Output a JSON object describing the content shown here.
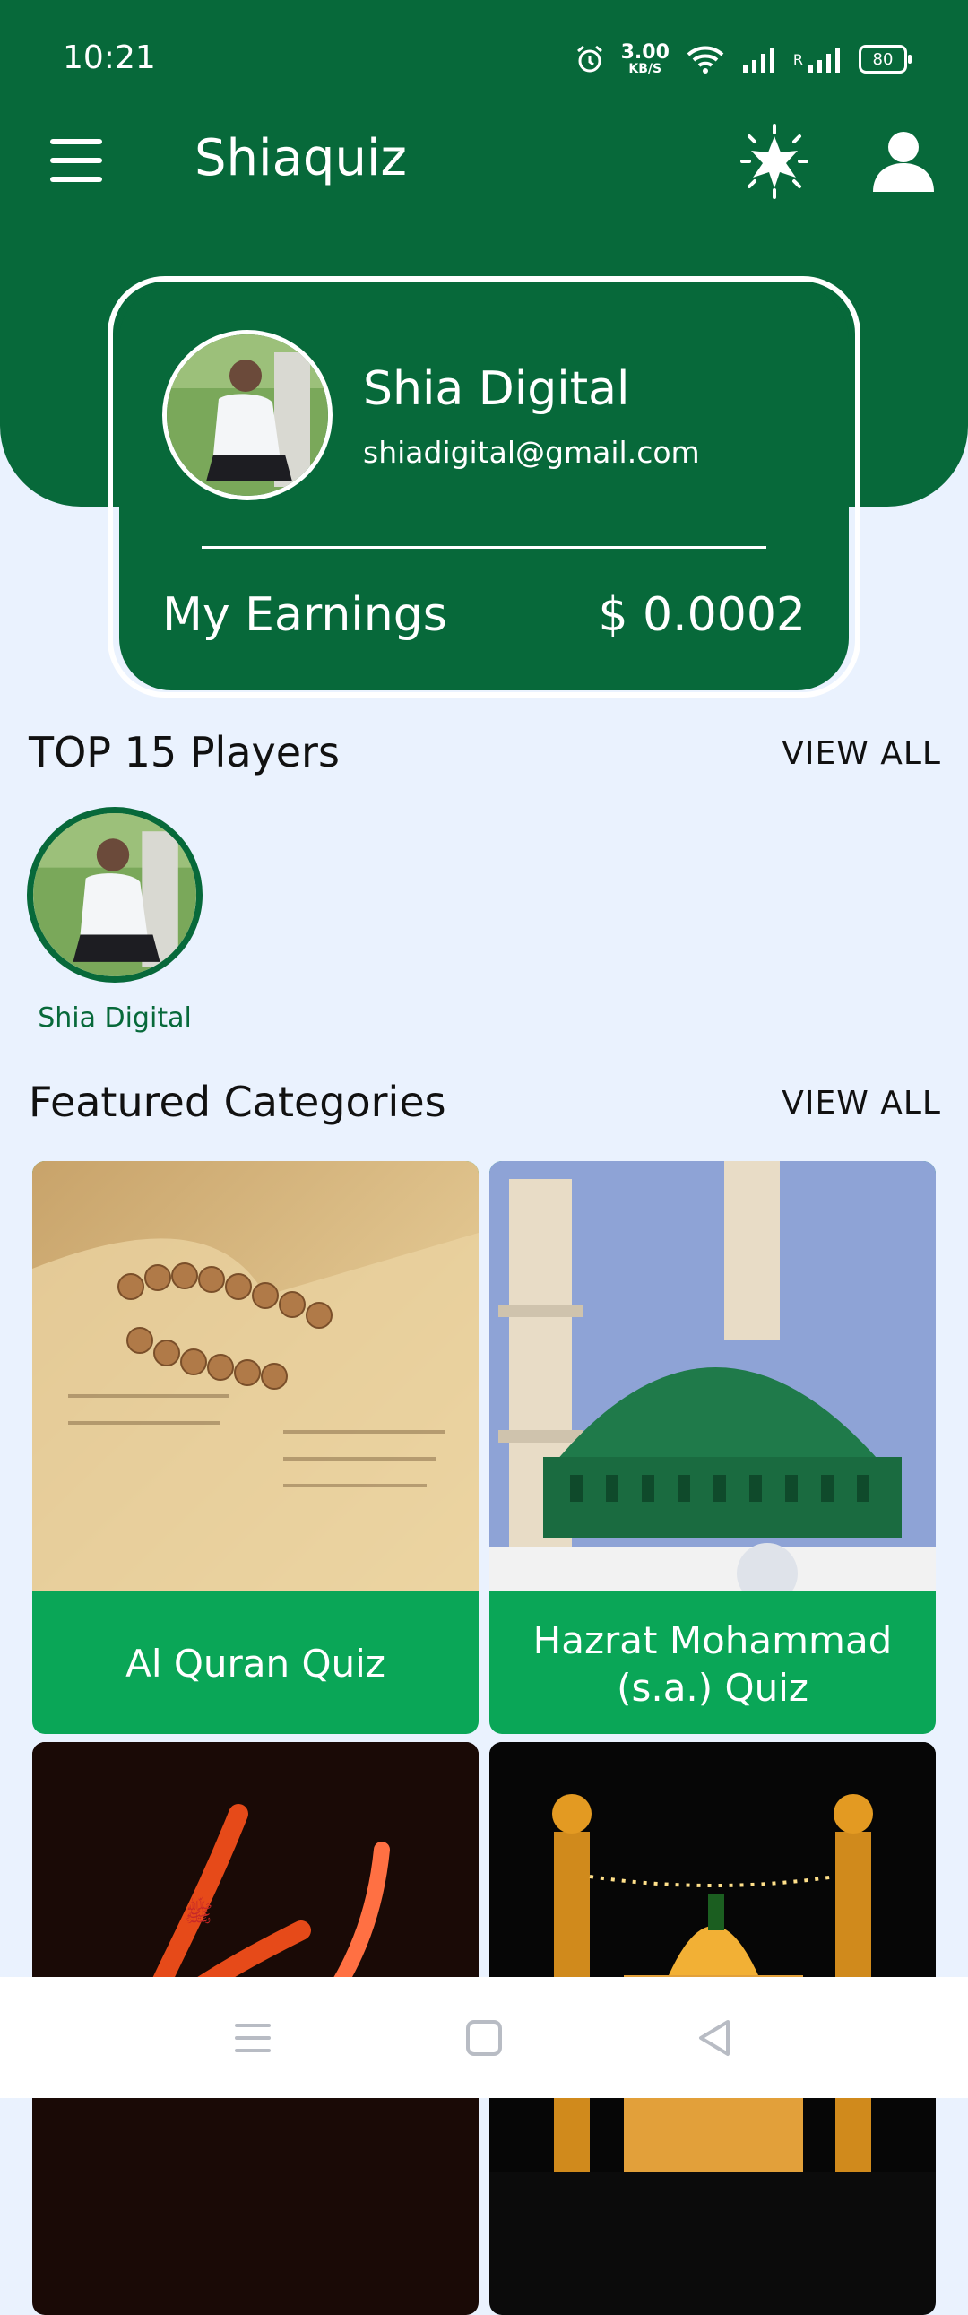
{
  "status_bar": {
    "time": "10:21",
    "net_speed_value": "3.00",
    "net_speed_unit": "KB/S",
    "roaming": "R",
    "battery": "80"
  },
  "app_bar": {
    "title": "Shiaquiz",
    "icons": [
      "menu-icon",
      "star-burst-icon",
      "profile-icon"
    ]
  },
  "profile_card": {
    "name": "Shia Digital",
    "email": "shiadigital@gmail.com",
    "earnings_label": "My Earnings",
    "earnings_value": "$ 0.0002"
  },
  "top_players": {
    "title": "TOP 15 Players",
    "view_all": "VIEW ALL",
    "players": [
      {
        "name": "Shia Digital"
      }
    ]
  },
  "featured_categories": {
    "title": "Featured Categories",
    "view_all": "VIEW ALL",
    "items": [
      {
        "label": "Al Quran Quiz"
      },
      {
        "label": "Hazrat Mohammad (s.a.) Quiz"
      },
      {
        "label": ""
      },
      {
        "label": ""
      }
    ]
  },
  "colors": {
    "primary": "#07693a",
    "accent": "#0aa657",
    "background": "#eaf2fe"
  },
  "nav_bar": {
    "icons": [
      "recent-apps-icon",
      "home-icon",
      "back-icon"
    ]
  }
}
